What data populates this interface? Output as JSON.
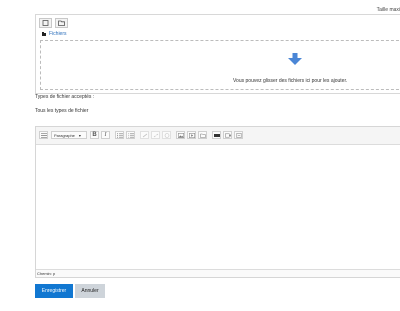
{
  "header": {
    "max_size_label": "Taille maxi"
  },
  "file_manager": {
    "path_label": "Fichiers",
    "drop_text": "Vous pouvez glisser des fichiers ici pour les ajouter."
  },
  "file_types": {
    "label": "Types de fichier acceptés :",
    "value": "Tous les types de fichier"
  },
  "editor": {
    "format_select": "Paragraphe",
    "bold_label": "B",
    "italic_label": "I",
    "status_path": "Chemin: p"
  },
  "actions": {
    "save_label": "Enregistrer",
    "cancel_label": "Annuler"
  },
  "colors": {
    "accent": "#1177d1",
    "drop_arrow": "#4a86d6",
    "link": "#2a6ebb"
  }
}
